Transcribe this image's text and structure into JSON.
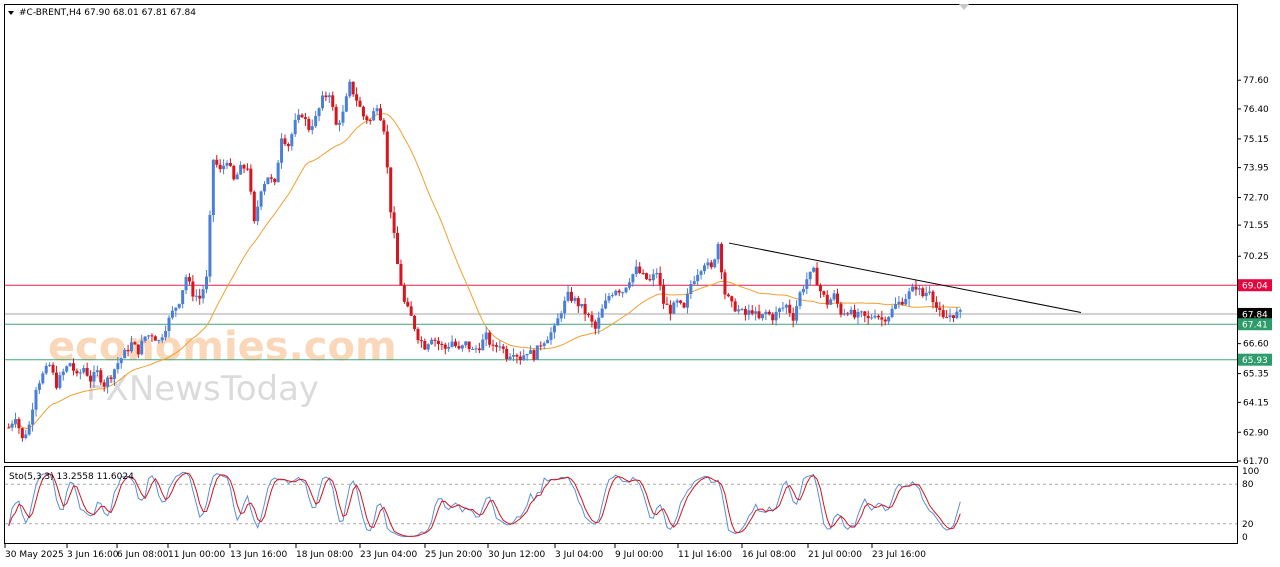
{
  "header": {
    "symbol_line": "#C-BRENT,H4  67.90 68.01 67.81 67.84"
  },
  "watermark": {
    "line1": "economies.com",
    "line2": "FXNewsToday"
  },
  "oscillator": {
    "label": "Sto(5,3,3) 13.2558 11.6024",
    "ticks": [
      "100",
      "80",
      "20",
      "0"
    ]
  },
  "chart_data": {
    "type": "candlestick",
    "symbol": "#C-BRENT",
    "timeframe": "H4",
    "last_ohlc": {
      "open": 67.9,
      "high": 68.01,
      "low": 67.81,
      "close": 67.84
    },
    "y_ticks": [
      "77.60",
      "76.40",
      "75.15",
      "73.95",
      "72.70",
      "71.55",
      "70.25",
      "69.04",
      "67.84",
      "67.41",
      "66.60",
      "65.93",
      "65.35",
      "64.15",
      "62.90",
      "61.70"
    ],
    "y_range": [
      61.7,
      78.4
    ],
    "x_labels": [
      "30 May 2025",
      "3 Jun 16:00",
      "6 Jun 08:00",
      "11 Jun 00:00",
      "13 Jun 16:00",
      "18 Jun 08:00",
      "23 Jun 04:00",
      "25 Jun 20:00",
      "30 Jun 12:00",
      "3 Jul 04:00",
      "9 Jul 00:00",
      "11 Jul 16:00",
      "16 Jul 08:00",
      "21 Jul 00:00",
      "23 Jul 16:00"
    ],
    "horizontal_levels": [
      {
        "value": 69.04,
        "label": "69.04",
        "color": "#e4073f"
      },
      {
        "value": 67.84,
        "label": "67.84",
        "color": "#000000"
      },
      {
        "value": 67.41,
        "label": "67.41",
        "color": "#2e9c6a"
      },
      {
        "value": 65.93,
        "label": "65.93",
        "color": "#2e9c6a"
      }
    ],
    "trendline": {
      "from": {
        "x": "11 Jul 16:00",
        "y": 70.8
      },
      "to": {
        "x": "end",
        "y": 67.9
      },
      "color": "#000000"
    },
    "moving_average": {
      "color": "#f0a030"
    },
    "colors": {
      "bull": "#4a7fd6",
      "bear": "#d6151c"
    },
    "path": [
      63.1,
      63.6,
      62.6,
      63.2,
      64.8,
      65.3,
      65.7,
      64.9,
      65.4,
      65.8,
      65.2,
      65.6,
      65.1,
      65.4,
      64.9,
      65.3,
      65.8,
      66.2,
      66.6,
      66.3,
      66.9,
      67.0,
      66.7,
      67.3,
      67.9,
      68.4,
      69.4,
      68.7,
      68.5,
      69.3,
      74.3,
      73.8,
      74.3,
      73.4,
      73.9,
      74.0,
      71.6,
      73.1,
      73.6,
      73.2,
      75.3,
      74.9,
      75.8,
      76.2,
      75.6,
      76.0,
      76.8,
      77.1,
      75.7,
      76.2,
      77.4,
      76.8,
      76.1,
      75.9,
      76.6,
      75.6,
      72.2,
      69.9,
      68.3,
      67.7,
      66.9,
      66.5,
      66.9,
      66.6,
      66.4,
      66.7,
      66.3,
      66.6,
      66.3,
      66.5,
      66.9,
      66.4,
      66.6,
      66.1,
      66.3,
      66.0,
      66.3,
      66.1,
      66.6,
      66.9,
      67.2,
      68.0,
      68.6,
      68.4,
      68.1,
      67.7,
      67.2,
      68.0,
      68.6,
      68.9,
      68.8,
      69.3,
      69.7,
      69.4,
      69.2,
      69.6,
      68.3,
      68.0,
      68.3,
      68.0,
      69.1,
      69.6,
      70.0,
      69.7,
      70.8,
      68.7,
      68.2,
      68.0,
      67.8,
      68.0,
      67.6,
      67.9,
      67.7,
      68.0,
      68.2,
      67.7,
      68.7,
      69.3,
      69.6,
      68.8,
      68.3,
      68.6,
      67.9,
      68.0,
      67.7,
      67.8,
      67.6,
      67.9,
      67.6,
      67.8,
      68.2,
      68.4,
      68.7,
      69.0,
      68.6,
      68.9,
      68.1,
      67.6,
      67.8,
      67.84
    ]
  }
}
